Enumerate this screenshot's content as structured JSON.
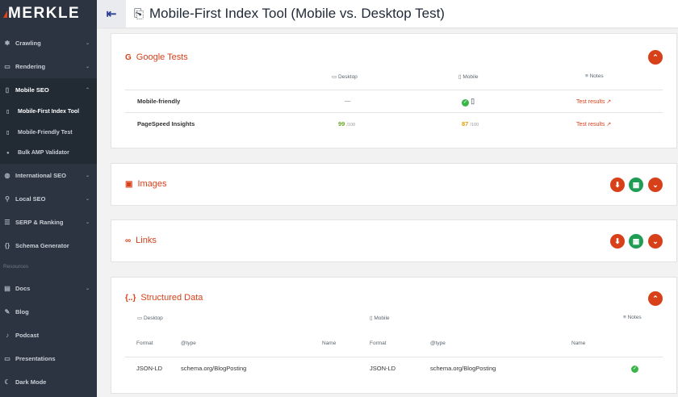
{
  "brand": {
    "logo": "MERKLE",
    "accent": "#d8401a"
  },
  "header": {
    "title": "Mobile-First Index Tool (Mobile vs. Desktop Test)",
    "menu_icon": "collapse-arrow-icon"
  },
  "sidebar": {
    "items": [
      {
        "label": "Crawling",
        "icon": "spider-icon"
      },
      {
        "label": "Rendering",
        "icon": "monitor-icon"
      },
      {
        "label": "Mobile SEO",
        "icon": "mobile-icon"
      },
      {
        "label": "International SEO",
        "icon": "globe-icon"
      },
      {
        "label": "Local SEO",
        "icon": "pin-icon"
      },
      {
        "label": "SERP & Ranking",
        "icon": "list-icon"
      },
      {
        "label": "Schema Generator",
        "icon": "braces-icon"
      }
    ],
    "subitems": [
      {
        "label": "Mobile-First Index Tool"
      },
      {
        "label": "Mobile-Friendly Test"
      },
      {
        "label": "Bulk AMP Validator"
      }
    ],
    "section_label": "Resources",
    "resources": [
      {
        "label": "Docs"
      },
      {
        "label": "Blog"
      },
      {
        "label": "Podcast"
      },
      {
        "label": "Presentations"
      },
      {
        "label": "Dark Mode"
      }
    ]
  },
  "google_tests": {
    "title": "Google Tests",
    "col_desktop": "Desktop",
    "col_mobile": "Mobile",
    "col_notes": "Notes",
    "rows": [
      {
        "label": "Mobile-friendly",
        "desktop": "—",
        "mobile": "✓",
        "notes": "Test results"
      },
      {
        "label": "PageSpeed Insights",
        "desktop": "99",
        "desktop_unit": "/100",
        "mobile": "87",
        "mobile_unit": "/100",
        "notes": "Test results"
      }
    ]
  },
  "images": {
    "title": "Images"
  },
  "links": {
    "title": "Links"
  },
  "structured_data": {
    "title": "Structured Data",
    "col_desktop": "Desktop",
    "col_mobile": "Mobile",
    "col_notes": "Notes",
    "sub_headers": [
      "Format",
      "@type",
      "Name",
      "Format",
      "@type",
      "Name"
    ],
    "row": {
      "d_format": "JSON-LD",
      "d_type": "schema.org/BlogPosting",
      "m_format": "JSON-LD",
      "m_type": "schema.org/BlogPosting"
    }
  }
}
